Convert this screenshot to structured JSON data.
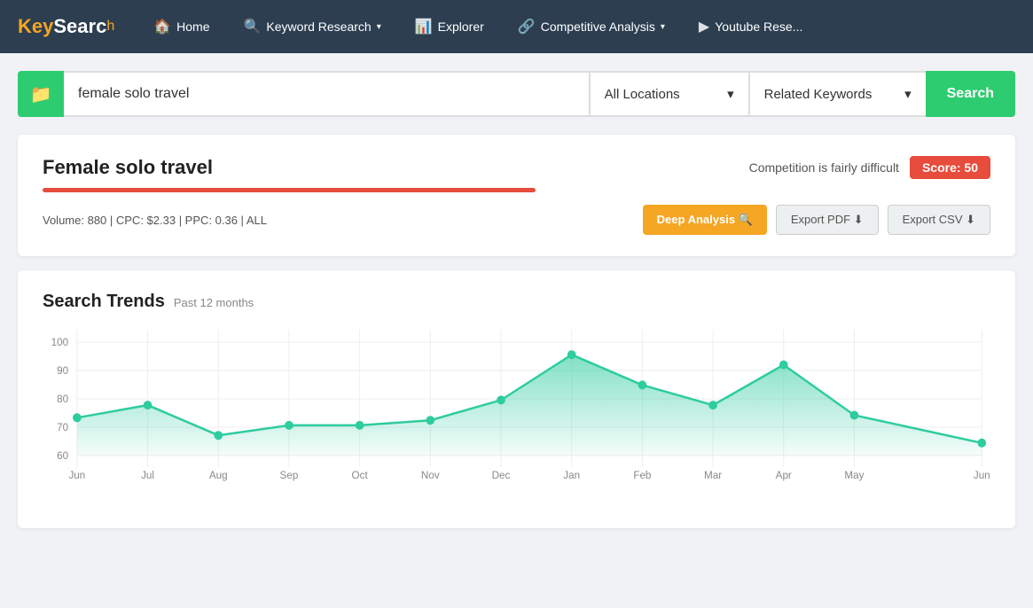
{
  "nav": {
    "logo_key": "Key",
    "logo_search": "Searc",
    "logo_o": "h",
    "items": [
      {
        "label": "Home",
        "icon": "🏠",
        "has_dropdown": false
      },
      {
        "label": "Keyword Research",
        "icon": "🔍",
        "has_dropdown": true
      },
      {
        "label": "Explorer",
        "icon": "📊",
        "has_dropdown": false
      },
      {
        "label": "Competitive Analysis",
        "icon": "🔗",
        "has_dropdown": true
      },
      {
        "label": "Youtube Rese...",
        "icon": "▶",
        "has_dropdown": false
      }
    ]
  },
  "search_bar": {
    "folder_icon": "📁",
    "input_value": "female solo travel",
    "location_label": "All Locations",
    "keyword_type_label": "Related Keywords",
    "search_button_label": "Search"
  },
  "result": {
    "keyword": "Female solo travel",
    "competition_text": "Competition is fairly difficult",
    "score_label": "Score: 50",
    "difficulty_percent": 52,
    "stats": "Volume: 880 | CPC: $2.33 | PPC: 0.36 | ALL",
    "btn_deep": "Deep Analysis 🔍",
    "btn_pdf": "Export PDF ⬇",
    "btn_csv": "Export CSV ⬇"
  },
  "trends": {
    "title": "Search Trends",
    "subtitle": "Past 12 months",
    "y_labels": [
      "100",
      "90",
      "80",
      "70",
      "60"
    ],
    "x_labels": [
      "Jun",
      "Jul",
      "Aug",
      "Sep",
      "Oct",
      "Nov",
      "Dec",
      "Jan",
      "Feb",
      "Mar",
      "Apr",
      "May",
      "Jun"
    ],
    "data_points": [
      75,
      80,
      68,
      72,
      72,
      74,
      82,
      100,
      88,
      80,
      96,
      76,
      65
    ],
    "chart_color": "#2ecc9e",
    "y_min": 60,
    "y_max": 105
  }
}
